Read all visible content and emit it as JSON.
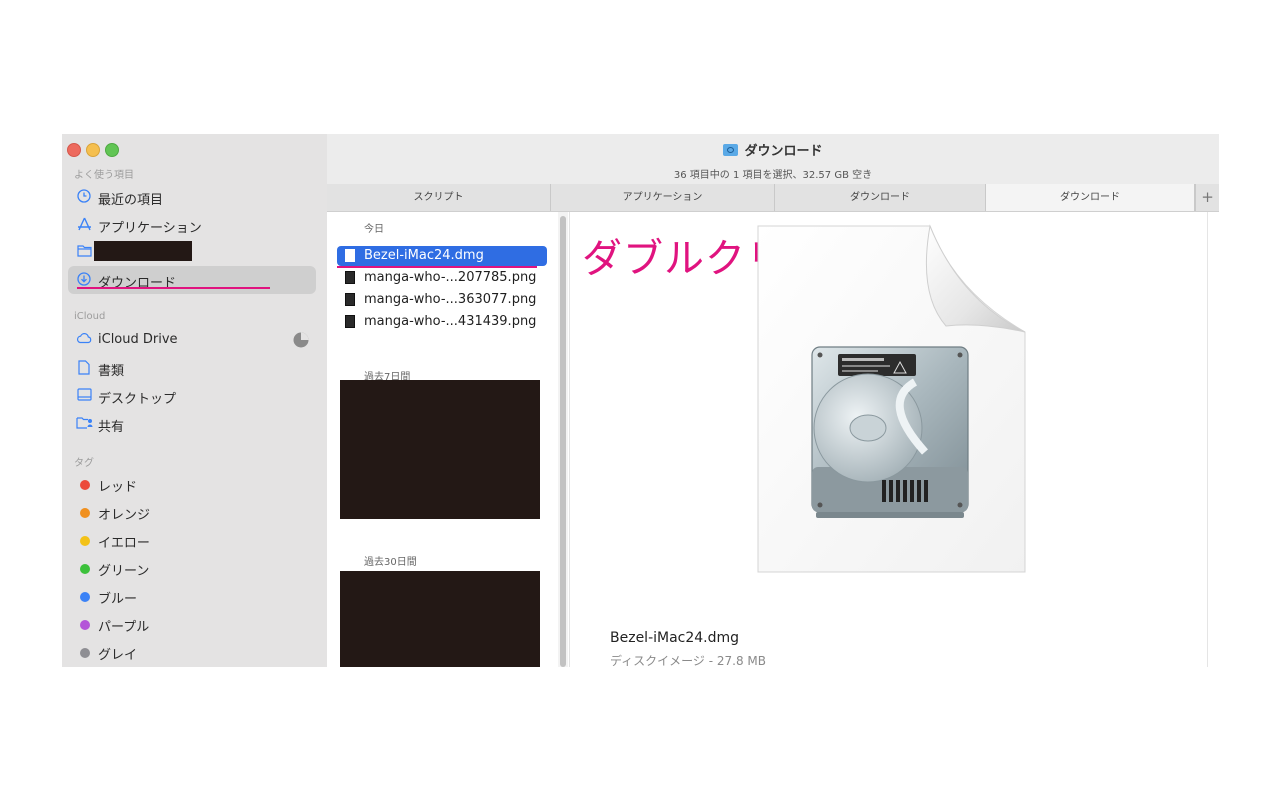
{
  "window": {
    "title": "ダウンロード",
    "status": "36 項目中の 1 項目を選択、32.57 GB 空き"
  },
  "sidebar": {
    "favorites_label": "よく使う項目",
    "favorites": [
      {
        "label": "最近の項目",
        "icon": "clock-icon"
      },
      {
        "label": "アプリケーション",
        "icon": "apps-icon"
      },
      {
        "label": "",
        "icon": "folder-icon",
        "redacted": true
      },
      {
        "label": "ダウンロード",
        "icon": "download-icon",
        "selected": true
      }
    ],
    "icloud_label": "iCloud",
    "icloud": [
      {
        "label": "iCloud Drive",
        "icon": "cloud-icon"
      },
      {
        "label": "書類",
        "icon": "document-icon"
      },
      {
        "label": "デスクトップ",
        "icon": "desktop-icon"
      },
      {
        "label": "共有",
        "icon": "shared-folder-icon"
      }
    ],
    "tags_label": "タグ",
    "tags": [
      {
        "label": "レッド",
        "color": "#ec4a3b"
      },
      {
        "label": "オレンジ",
        "color": "#f0901f"
      },
      {
        "label": "イエロー",
        "color": "#f3c218"
      },
      {
        "label": "グリーン",
        "color": "#3cc13b"
      },
      {
        "label": "ブルー",
        "color": "#3b82f6"
      },
      {
        "label": "パープル",
        "color": "#b455d8"
      },
      {
        "label": "グレイ",
        "color": "#8e8e93"
      }
    ]
  },
  "tabs": [
    {
      "label": "スクリプト"
    },
    {
      "label": "アプリケーション"
    },
    {
      "label": "ダウンロード"
    },
    {
      "label": "ダウンロード",
      "active": true
    }
  ],
  "tab_add": "+",
  "filelist": {
    "today_label": "今日",
    "files": [
      {
        "name": "Bezel-iMac24.dmg",
        "selected": true
      },
      {
        "name": "manga-who-...207785.png"
      },
      {
        "name": "manga-who-...363077.png"
      },
      {
        "name": "manga-who-...431439.png"
      }
    ],
    "past7_label": "過去7日間",
    "past30_label": "過去30日間"
  },
  "preview": {
    "annotation": "ダブルクリック",
    "file_name": "Bezel-iMac24.dmg",
    "file_info": "ディスクイメージ - 27.8 MB"
  },
  "colors": {
    "annotation": "#e0137f",
    "selection": "#2f6de3",
    "accent": "#3a82f7"
  }
}
